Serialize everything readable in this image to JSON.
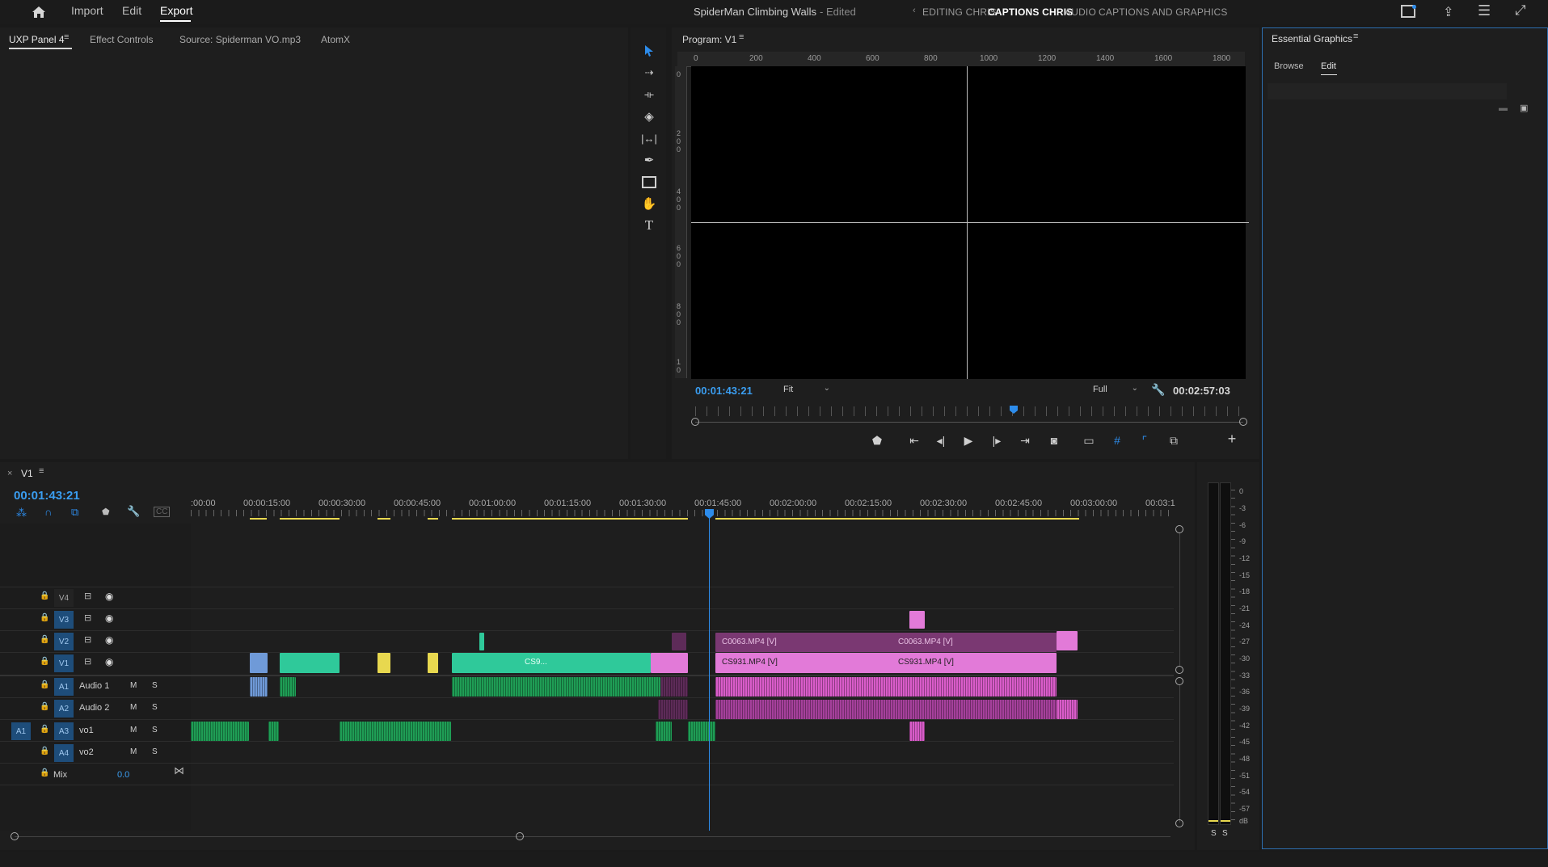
{
  "menu": {
    "home_icon": "home-icon",
    "items": [
      "Import",
      "Edit",
      "Export"
    ],
    "active": "Export"
  },
  "project": {
    "title": "SpiderMan Climbing Walls",
    "state": "- Edited"
  },
  "workspaces": {
    "items": [
      "EDITING CHRIS",
      "CAPTIONS CHRIS",
      "AUDIO",
      "CAPTIONS AND GRAPHICS"
    ],
    "active": "CAPTIONS CHRIS"
  },
  "source_panel": {
    "tabs": [
      "UXP Panel 4",
      "Effect Controls",
      "Source: Spiderman VO.mp3",
      "AtomX"
    ]
  },
  "program": {
    "title": "Program: V1",
    "ruler": [
      "0",
      "200",
      "400",
      "600",
      "800",
      "1000",
      "1200",
      "1400",
      "1600",
      "1800"
    ],
    "vruler": [
      "0",
      "2 0 0",
      "4 0 0",
      "6 0 0",
      "8 0 0",
      "1 0"
    ],
    "current_tc": "00:01:43:21",
    "fit": "Fit",
    "quality": "Full",
    "duration_tc": "00:02:57:03"
  },
  "essential_graphics": {
    "title": "Essential Graphics",
    "tabs": [
      "Browse",
      "Edit"
    ],
    "active": "Edit"
  },
  "timeline": {
    "sequence": "V1",
    "current_tc": "00:01:43:21",
    "ruler": [
      ":00:00",
      "00:00:15:00",
      "00:00:30:00",
      "00:00:45:00",
      "00:01:00:00",
      "00:01:15:00",
      "00:01:30:00",
      "00:01:45:00",
      "00:02:00:00",
      "00:02:15:00",
      "00:02:30:00",
      "00:02:45:00",
      "00:03:00:00",
      "00:03:1"
    ],
    "video_tracks": [
      {
        "id": "V4"
      },
      {
        "id": "V3"
      },
      {
        "id": "V2"
      },
      {
        "id": "V1"
      }
    ],
    "audio_tracks": [
      {
        "id": "A1",
        "name": "Audio 1"
      },
      {
        "id": "A2",
        "name": "Audio 2"
      },
      {
        "id": "A3",
        "name": "vo1",
        "source": "A1"
      },
      {
        "id": "A4",
        "name": "vo2"
      }
    ],
    "mix": {
      "label": "Mix",
      "value": "0.0"
    },
    "clip_labels": {
      "c0063": "C0063.MP4 [V]",
      "c0063b": "C0063.MP4 [V]",
      "cs931": "CS931.MP4 [V]",
      "cs931b": "CS931.MP4 [V]",
      "cs9": "CS9..."
    }
  },
  "meter": {
    "scale": [
      "0",
      "-3",
      "-6",
      "-9",
      "-12",
      "-15",
      "-18",
      "-21",
      "-24",
      "-27",
      "-30",
      "-33",
      "-36",
      "-39",
      "-42",
      "-45",
      "-48",
      "-51",
      "-54",
      "-57",
      "dB"
    ],
    "solo": [
      "S",
      "S"
    ]
  },
  "colors": {
    "accent": "#2d8ceb",
    "video_green": "#2fc99a",
    "video_pink": "#e27ad8",
    "audio_green": "#1f9d55",
    "audio_pink": "#d95cc9",
    "yellow": "#e8d84f",
    "blue_clip": "#6f9ad8"
  }
}
